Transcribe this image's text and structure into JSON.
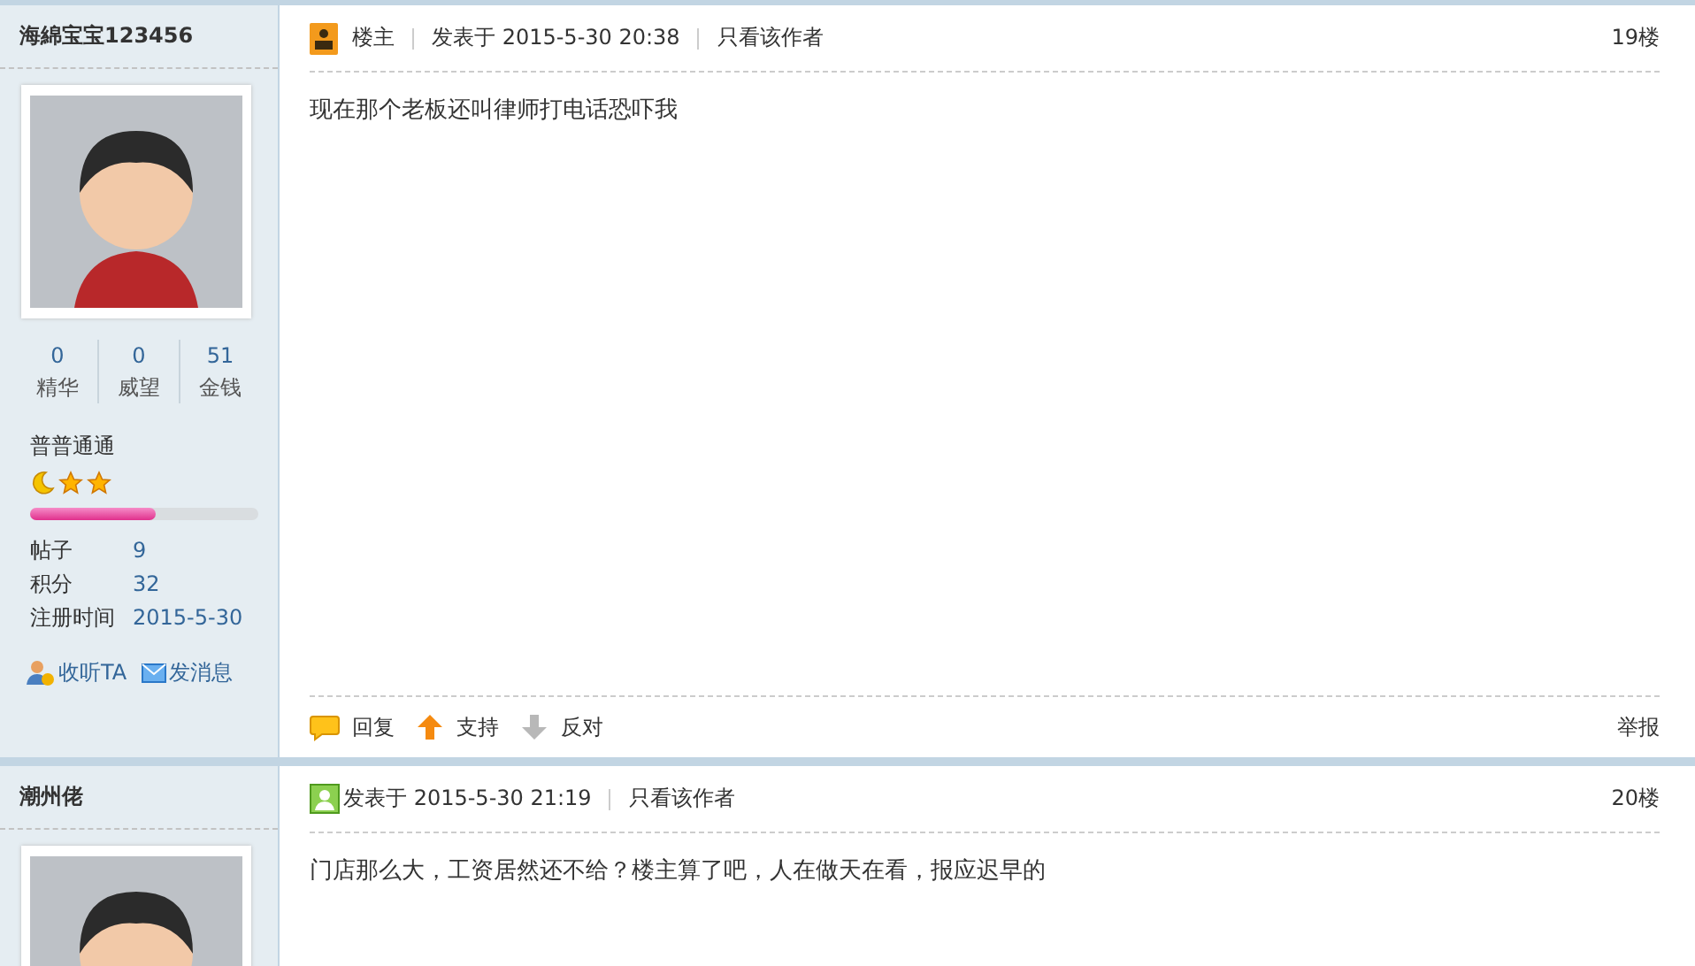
{
  "posts": [
    {
      "user": {
        "name": "海綿宝宝123456",
        "stats": [
          {
            "value": "0",
            "label": "精华"
          },
          {
            "value": "0",
            "label": "威望"
          },
          {
            "value": "51",
            "label": "金钱"
          }
        ],
        "rank": "普普通通",
        "rank_icons": [
          {
            "kind": "moon"
          },
          {
            "kind": "star"
          },
          {
            "kind": "star"
          }
        ],
        "level": 0.55,
        "info": [
          {
            "label": "帖子",
            "value": "9"
          },
          {
            "label": "积分",
            "value": "32"
          },
          {
            "label": "注册时间",
            "value": "2015-5-30"
          }
        ],
        "actions": [
          {
            "kind": "follow",
            "label": "收听TA"
          },
          {
            "kind": "message",
            "label": "发消息"
          }
        ]
      },
      "badge": {
        "kind": "owner",
        "label": "楼主"
      },
      "posted": "发表于 2015-5-30 20:38",
      "author_only": "只看该作者",
      "floor": "19楼",
      "content": "现在那个老板还叫律师打电话恐吓我",
      "footer": {
        "actions": [
          {
            "kind": "reply",
            "label": "回复"
          },
          {
            "kind": "up",
            "label": "支持"
          },
          {
            "kind": "down",
            "label": "反对"
          }
        ],
        "report": "举报"
      }
    },
    {
      "user": {
        "name": "潮州佬"
      },
      "badge": {
        "kind": "member"
      },
      "posted": "发表于 2015-5-30 21:19",
      "author_only": "只看该作者",
      "floor": "20楼",
      "content": "门店那么大，工资居然还不给？楼主算了吧，人在做天在看，报应迟早的"
    }
  ]
}
